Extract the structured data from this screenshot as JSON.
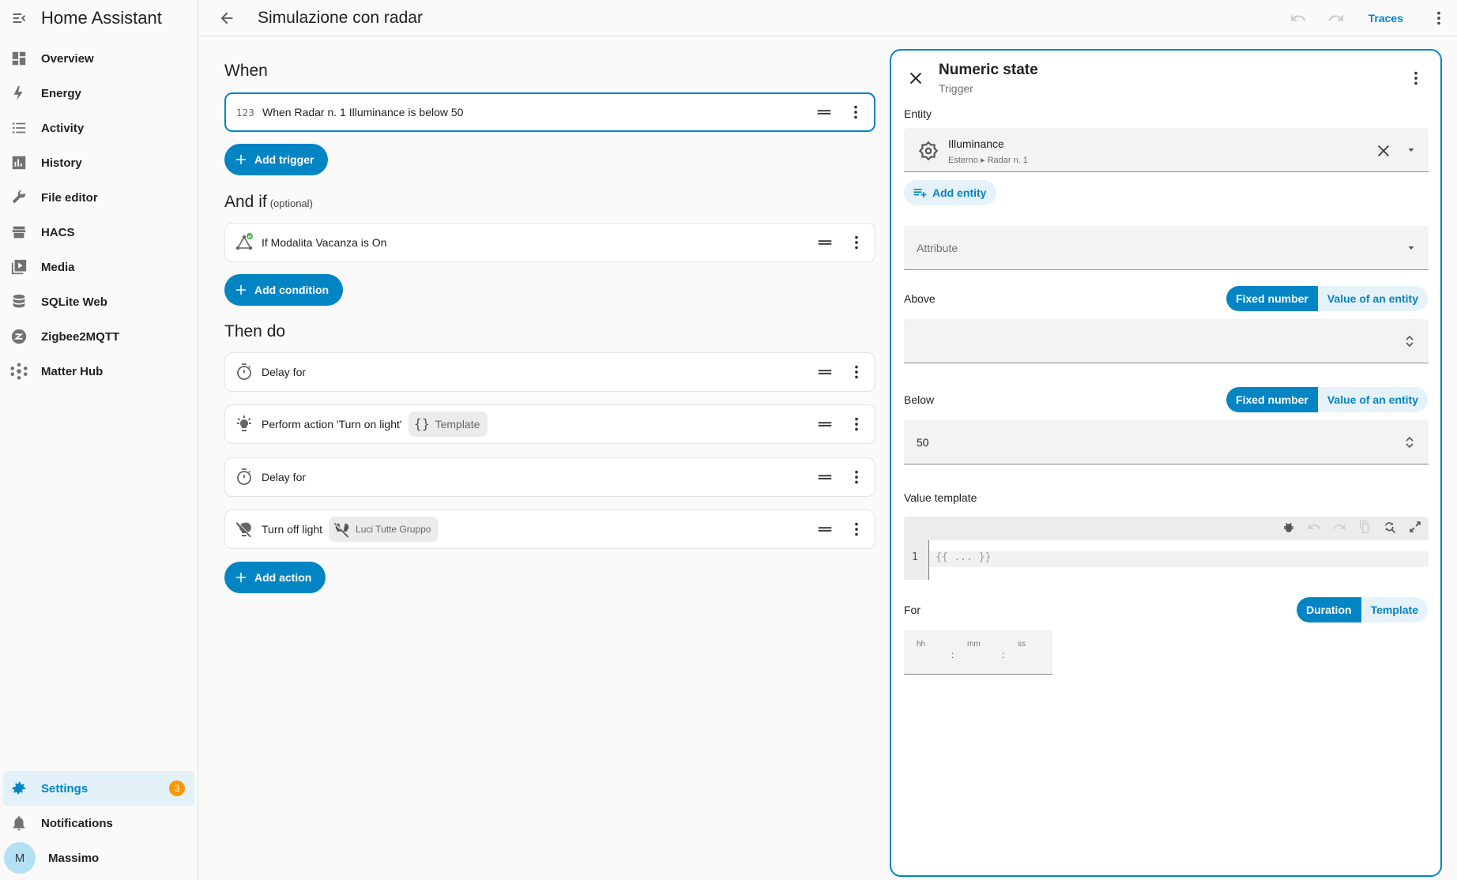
{
  "app": {
    "title": "Home Assistant"
  },
  "sidebar": {
    "items": [
      {
        "label": "Overview",
        "icon": "overview-icon"
      },
      {
        "label": "Energy",
        "icon": "energy-icon"
      },
      {
        "label": "Activity",
        "icon": "activity-icon"
      },
      {
        "label": "History",
        "icon": "history-icon"
      },
      {
        "label": "File editor",
        "icon": "file-editor-icon"
      },
      {
        "label": "HACS",
        "icon": "hacs-icon"
      },
      {
        "label": "Media",
        "icon": "media-icon"
      },
      {
        "label": "SQLite Web",
        "icon": "database-icon"
      },
      {
        "label": "Zigbee2MQTT",
        "icon": "zigbee-icon"
      },
      {
        "label": "Matter Hub",
        "icon": "matter-hub-icon"
      }
    ],
    "bottom": {
      "settings": {
        "label": "Settings",
        "badge": "3"
      },
      "notifications": {
        "label": "Notifications"
      },
      "user": {
        "label": "Massimo",
        "initial": "M"
      }
    }
  },
  "header": {
    "title": "Simulazione con radar",
    "traces_label": "Traces"
  },
  "editor": {
    "when": {
      "heading": "When",
      "trigger": "When Radar n. 1 Illuminance is below 50",
      "add_label": "Add trigger"
    },
    "andif": {
      "heading": "And if",
      "optional": "(optional)",
      "condition": "If Modalita Vacanza is On",
      "add_label": "Add condition"
    },
    "then": {
      "heading": "Then do",
      "actions": [
        {
          "label": "Delay for"
        },
        {
          "label": "Perform action 'Turn on light'",
          "chip": "Template"
        },
        {
          "label": "Delay for"
        },
        {
          "label": "Turn off light",
          "chip": "Luci Tutte Gruppo"
        }
      ],
      "add_label": "Add action"
    }
  },
  "panel": {
    "title": "Numeric state",
    "subtitle": "Trigger",
    "entity": {
      "label": "Entity",
      "name": "Illuminance",
      "path_area": "Esterno",
      "path_device": "Radar n. 1",
      "add_label": "Add entity"
    },
    "attribute": {
      "placeholder": "Attribute"
    },
    "above": {
      "label": "Above",
      "seg_on": "Fixed number",
      "seg_off": "Value of an entity",
      "value": ""
    },
    "below": {
      "label": "Below",
      "seg_on": "Fixed number",
      "seg_off": "Value of an entity",
      "value": "50"
    },
    "value_template": {
      "label": "Value template",
      "line_no": "1",
      "placeholder": "{{ ... }}"
    },
    "for": {
      "label": "For",
      "seg_on": "Duration",
      "seg_off": "Template",
      "hh": "hh",
      "mm": "mm",
      "ss": "ss"
    }
  },
  "colors": {
    "accent": "#0385c4",
    "badge": "#ff9800",
    "success": "#4caf50"
  }
}
